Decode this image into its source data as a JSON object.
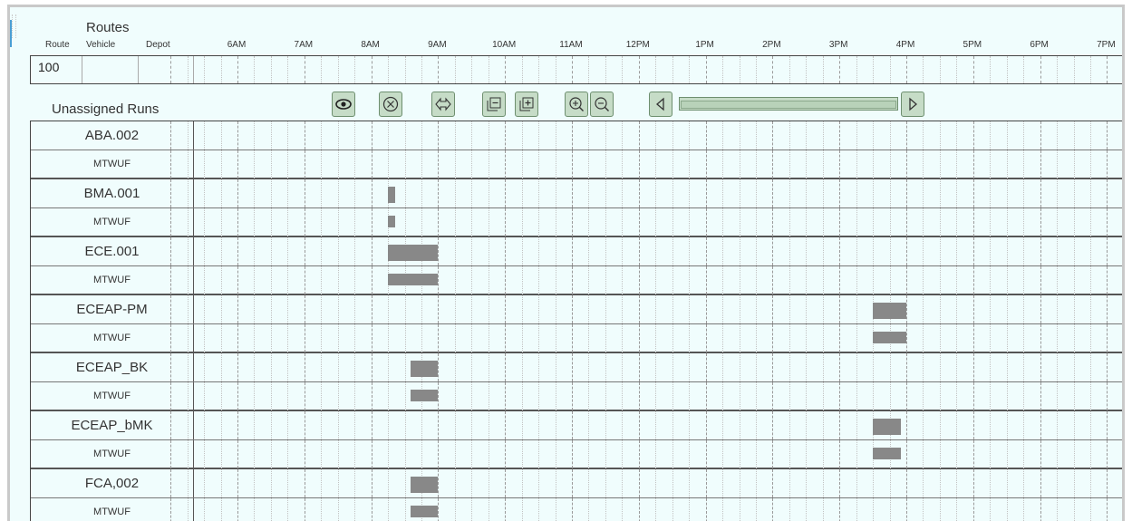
{
  "header": {
    "title": "Routes",
    "columns": [
      "Route",
      "Vehicle",
      "Depot"
    ]
  },
  "route_row": {
    "route": "100",
    "vehicle": "",
    "depot": ""
  },
  "time_axis": [
    "6AM",
    "7AM",
    "8AM",
    "9AM",
    "10AM",
    "11AM",
    "12PM",
    "1PM",
    "2PM",
    "3PM",
    "4PM",
    "5PM",
    "6PM",
    "7PM"
  ],
  "unassigned": {
    "title": "Unassigned Runs"
  },
  "toolbar": {
    "buttons": [
      {
        "name": "view-button",
        "icon": "eye-icon"
      },
      {
        "name": "clear-button",
        "icon": "circle-x-icon"
      },
      {
        "name": "swap-button",
        "icon": "double-arrow-icon"
      },
      {
        "name": "collapse-button",
        "icon": "collapse-rows-icon"
      },
      {
        "name": "expand-button",
        "icon": "expand-rows-icon"
      },
      {
        "name": "zoom-in-button",
        "icon": "zoom-in-icon"
      },
      {
        "name": "zoom-out-button",
        "icon": "zoom-out-icon"
      },
      {
        "name": "scroll-left-button",
        "icon": "triangle-left-icon"
      },
      {
        "name": "scroll-right-button",
        "icon": "triangle-right-icon"
      }
    ],
    "colors": {
      "button_fill": "#c6dcc7",
      "button_border": "#6e8f6f"
    }
  },
  "runs": [
    {
      "name": "ABA.002",
      "days": "MTWUF",
      "start": null,
      "end": null
    },
    {
      "name": "BMA.001",
      "days": "MTWUF",
      "start": "8:15",
      "end": "8:20"
    },
    {
      "name": "ECE.001",
      "days": "MTWUF",
      "start": "8:15",
      "end": "9:00"
    },
    {
      "name": "ECEAP-PM",
      "days": "MTWUF",
      "start": "3:30",
      "end": "4:00"
    },
    {
      "name": "ECEAP_BK",
      "days": "MTWUF",
      "start": "8:35",
      "end": "9:00"
    },
    {
      "name": "ECEAP_bMK",
      "days": "MTWUF",
      "start": "3:30",
      "end": "3:55"
    },
    {
      "name": "FCA,002",
      "days": "MTWUF",
      "start": "8:35",
      "end": "9:00"
    }
  ],
  "colors": {
    "background": "#f0fdfd",
    "bar": "#888888",
    "accent": "#4a9fd4"
  }
}
